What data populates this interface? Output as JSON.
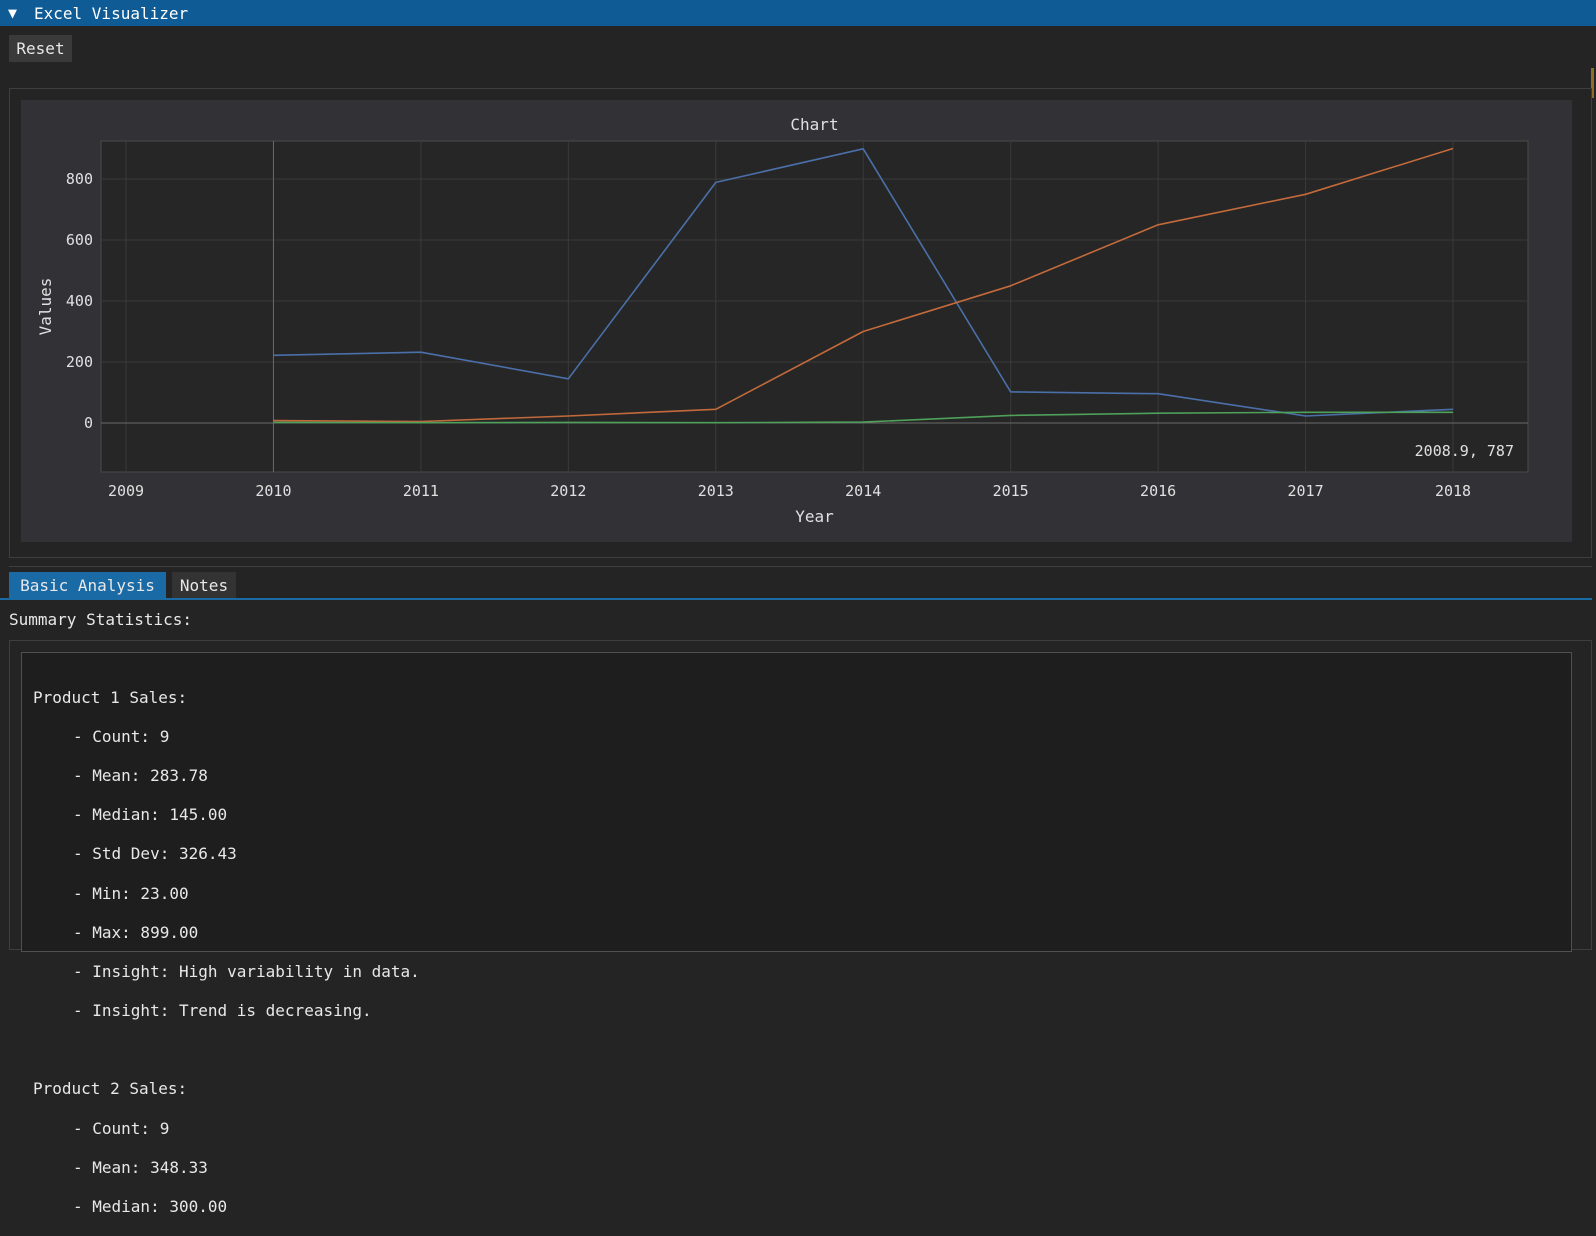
{
  "window": {
    "title": "Excel Visualizer",
    "collapse_arrow": "▼"
  },
  "toolbar": {
    "reset_label": "Reset"
  },
  "chart_data": {
    "type": "line",
    "title": "Chart",
    "xlabel": "Year",
    "ylabel": "Values",
    "xlim": [
      2009,
      2018
    ],
    "ylim": [
      -160,
      920
    ],
    "x_ticks": [
      2009,
      2010,
      2011,
      2012,
      2013,
      2014,
      2015,
      2016,
      2017,
      2018
    ],
    "y_ticks": [
      0,
      200,
      400,
      600,
      800
    ],
    "x": [
      2010,
      2011,
      2012,
      2013,
      2014,
      2015,
      2016,
      2017,
      2018
    ],
    "series": [
      {
        "color": "#4b6fa8",
        "values": [
          222,
          232,
          145,
          789,
          899,
          102,
          96,
          23,
          45
        ]
      },
      {
        "color": "#c26a3b",
        "values": [
          8,
          5,
          23,
          45,
          300,
          450,
          650,
          750,
          900
        ]
      },
      {
        "color": "#4ea05a",
        "values": [
          2,
          1,
          2,
          1,
          3,
          25,
          32,
          35,
          35
        ]
      }
    ],
    "grid": true,
    "cursor_readout": "2008.9, 787"
  },
  "tabs": [
    {
      "label": "Basic Analysis",
      "active": true
    },
    {
      "label": "Notes",
      "active": false
    }
  ],
  "summary": {
    "label": "Summary Statistics:",
    "products": [
      {
        "header": "Product 1 Sales:",
        "lines": [
          "- Count: 9",
          "- Mean: 283.78",
          "- Median: 145.00",
          "- Std Dev: 326.43",
          "- Min: 23.00",
          "- Max: 899.00",
          "- Insight: High variability in data.",
          "- Insight: Trend is decreasing."
        ]
      },
      {
        "header": "Product 2 Sales:",
        "lines": [
          "- Count: 9",
          "- Mean: 348.33",
          "- Median: 300.00"
        ]
      }
    ]
  }
}
